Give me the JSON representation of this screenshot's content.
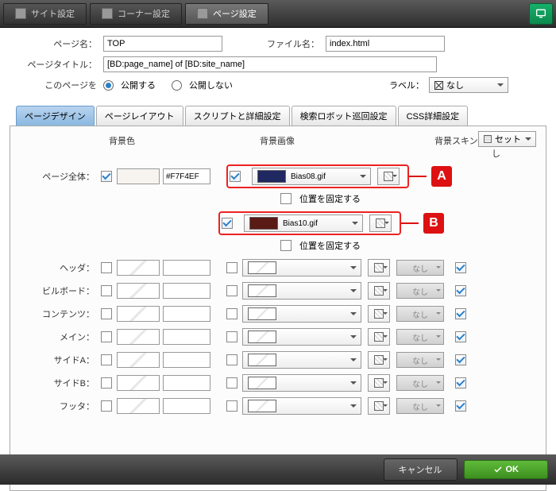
{
  "topbar": {
    "tabs": [
      "サイト設定",
      "コーナー設定",
      "ページ設定"
    ],
    "active": 2
  },
  "form": {
    "page_name_label": "ページ名：",
    "page_name_value": "TOP",
    "file_name_label": "ファイル名：",
    "file_name_value": "index.html",
    "page_title_label": "ページタイトル：",
    "page_title_value": "[BD:page_name] of [BD:site_name]",
    "this_page_label": "このページを",
    "publish": "公開する",
    "no_publish": "公開しない",
    "label_label": "ラベル：",
    "label_value": "なし"
  },
  "subtabs": [
    "ページデザイン",
    "ページレイアウト",
    "スクリプトと詳細設定",
    "検索ロボット巡回設定",
    "CSS詳細設定"
  ],
  "panel": {
    "set_btn": "セット",
    "headers": {
      "bgcolor": "背景色",
      "bgimage": "背景画像",
      "bgskin": "背景スキン",
      "nomargin": "余白なし"
    },
    "page_whole": "ページ全体：",
    "page_whole_hex": "#F7F4EF",
    "imgA": {
      "name": "Bias08.gif",
      "color": "#1f2860"
    },
    "imgB": {
      "name": "Bias10.gif",
      "color": "#5a1a15"
    },
    "fix_pos": "位置を固定する",
    "markerA": "A",
    "markerB": "B",
    "nashi": "なし",
    "rows": [
      "ヘッダ：",
      "ビルボード：",
      "コンテンツ：",
      "メイン：",
      "サイドA：",
      "サイドB：",
      "フッタ："
    ]
  },
  "footer": {
    "cancel": "キャンセル",
    "ok": "OK"
  }
}
